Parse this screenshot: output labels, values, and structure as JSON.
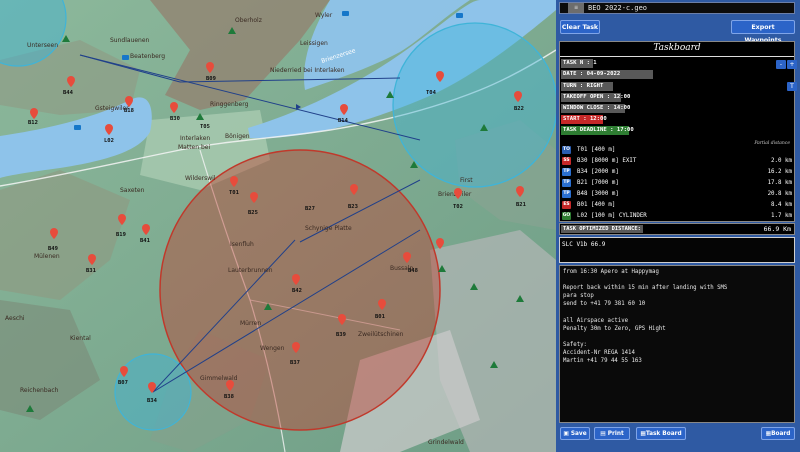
{
  "map": {
    "places": [
      {
        "id": "place-unterseen-top",
        "text": "Unterseen"
      },
      {
        "id": "place-sundlauenen",
        "text": "Sundlauenen"
      },
      {
        "id": "place-wyler",
        "text": "Wyler"
      },
      {
        "id": "place-oberholz",
        "text": "Oberholz"
      },
      {
        "id": "place-st-beatenberg",
        "text": "Beatenberg"
      },
      {
        "id": "place-leissigen",
        "text": "Leissigen"
      },
      {
        "id": "place-niederried",
        "text": "Niederried bei Interlaken"
      },
      {
        "id": "place-brienzersee",
        "text": "Brienzersee"
      },
      {
        "id": "place-ringgenberg",
        "text": "Ringgenberg"
      },
      {
        "id": "place-bonigen",
        "text": "Bönigen"
      },
      {
        "id": "place-interlaken",
        "text": "Interlaken"
      },
      {
        "id": "place-matten",
        "text": "Matten bei"
      },
      {
        "id": "place-wilderswil",
        "text": "Wilderswil"
      },
      {
        "id": "place-saxeten",
        "text": "Saxeten"
      },
      {
        "id": "place-isenfluh",
        "text": "Isenfluh"
      },
      {
        "id": "place-lauterbrunnen",
        "text": "Lauterbrunnen"
      },
      {
        "id": "place-murren",
        "text": "Mürren"
      },
      {
        "id": "place-gimmelwald",
        "text": "Gimmelwald"
      },
      {
        "id": "place-muhlebach",
        "text": "Mülenen"
      },
      {
        "id": "place-grindelwald",
        "text": "Grindelwald"
      },
      {
        "id": "place-schynige",
        "text": "Schynige Platte"
      },
      {
        "id": "place-first",
        "text": "First"
      },
      {
        "id": "place-bussalp",
        "text": "Bussalp"
      },
      {
        "id": "place-wengen",
        "text": "Wengen"
      },
      {
        "id": "place-zweilutschinen",
        "text": "Zweilütschinen"
      },
      {
        "id": "place-kiental",
        "text": "Kiental"
      },
      {
        "id": "place-reichenbach",
        "text": "Reichenbach"
      },
      {
        "id": "place-aeschi",
        "text": "Aeschi"
      },
      {
        "id": "place-mürren-lower",
        "text": "Brienzwiler"
      },
      {
        "id": "place-gsteigwiler",
        "text": "Gsteigwiler"
      }
    ],
    "waypoints": [
      {
        "id": "wp-b44",
        "label": "B44"
      },
      {
        "id": "wp-l02",
        "label": "L02"
      },
      {
        "id": "wp-b30",
        "label": "B30"
      },
      {
        "id": "wp-b34",
        "label": "B34"
      },
      {
        "id": "wp-t01",
        "label": "T01"
      },
      {
        "id": "wp-t02",
        "label": "T02"
      },
      {
        "id": "wp-b21",
        "label": "B21"
      },
      {
        "id": "wp-b23",
        "label": "B23"
      },
      {
        "id": "wp-b48",
        "label": "B48"
      },
      {
        "id": "wp-b01",
        "label": "B01"
      },
      {
        "id": "wp-b27",
        "label": "B27"
      },
      {
        "id": "wp-b37",
        "label": "B37"
      },
      {
        "id": "wp-b39",
        "label": "B39"
      },
      {
        "id": "wp-b42",
        "label": "B42"
      },
      {
        "id": "wp-b49",
        "label": "B49"
      },
      {
        "id": "wp-t04",
        "label": "T04"
      },
      {
        "id": "wp-b19",
        "label": "B19"
      },
      {
        "id": "wp-b41",
        "label": "B41"
      },
      {
        "id": "wp-b25",
        "label": "B25"
      },
      {
        "id": "wp-b22",
        "label": "B22"
      },
      {
        "id": "wp-b31",
        "label": "B31"
      },
      {
        "id": "wp-b14",
        "label": "B14"
      },
      {
        "id": "wp-b09",
        "label": "B09"
      },
      {
        "id": "wp-b18",
        "label": "B18"
      },
      {
        "id": "wp-b07",
        "label": "B07"
      },
      {
        "id": "wp-b38",
        "label": "B38"
      },
      {
        "id": "wp-b12",
        "label": "B12"
      },
      {
        "id": "wp-t05",
        "label": "T05"
      }
    ]
  },
  "panel": {
    "file_icon": "≡",
    "file_name": "BEO 2022-c.geo",
    "clear_task": "Clear Task",
    "export_waypoints": "Export Waypoints",
    "board_title": "Taskboard",
    "task_nr": "TASK N : 1",
    "date": "DATE : 04-09-2022",
    "turn": "TURN : RIGHT",
    "turn_btn": "T",
    "minus_btn": "-",
    "plus_btn": "+",
    "takeoff_open": "TAKEOFF OPEN : 12:00",
    "window_close": "WINDOW CLOSE : 14:00",
    "start": "START : 12:00",
    "task_deadline": "TASK DEADLINE : 17:00",
    "partial_distance": "Partial distance",
    "turnpoints": [
      {
        "badge": "TO",
        "name": "T01 [400 m]",
        "dist": "",
        "color": "#2a5db0"
      },
      {
        "badge": "SS",
        "name": "B30 [8000 m] EXIT",
        "dist": "2.0 km",
        "color": "#c62828"
      },
      {
        "badge": "TP",
        "name": "B34 [2000 m]",
        "dist": "16.2 km",
        "color": "#2a6fd0"
      },
      {
        "badge": "TP",
        "name": "B21 [7000 m]",
        "dist": "17.8 km",
        "color": "#2a6fd0"
      },
      {
        "badge": "TP",
        "name": "B48 [3000 m]",
        "dist": "20.8 km",
        "color": "#2a6fd0"
      },
      {
        "badge": "ES",
        "name": "B01 [400 m]",
        "dist": "8.4 km",
        "color": "#c62828"
      },
      {
        "badge": "GO",
        "name": "L02 [100 m] CYLINDER",
        "dist": "1.7 km",
        "color": "#2e7d32"
      }
    ],
    "optimized_label": "TASK OPTIMIZED DISTANCE:",
    "optimized_value": "66.9 Km",
    "slc": "SLC V1b 66.9",
    "notes": "from 16:30 Apero at Happymag\n\nReport back within 15 min after landing with SMS\npara stop\nsend to +41 79 381 60 10\n\nall Airspace active\nPenalty 30m to Zero, GPS Hight\n\nSafety:\nAccident-Nr REGA 1414\nMartin +41 79 44 55 163",
    "save": "Save",
    "print": "Print",
    "task_board": "Task Board",
    "board": "Board"
  },
  "colors": {
    "panel_bg": "#2f5aa3",
    "button": "#2c64c8",
    "cylinder_red": "#c0392b",
    "cylinder_blue": "#3fb4d8",
    "lake": "#8ec3ea"
  }
}
